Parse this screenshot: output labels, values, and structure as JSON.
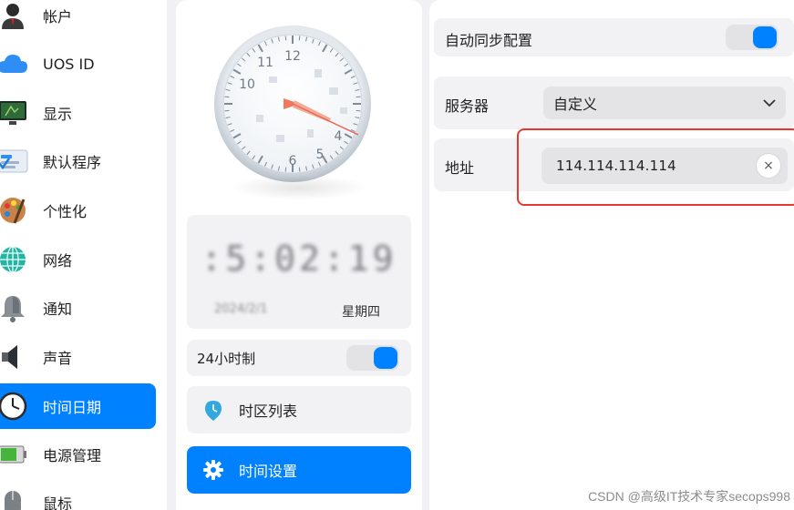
{
  "sidebar": {
    "items": [
      {
        "label": "帐户",
        "icon": "user-icon"
      },
      {
        "label": "UOS ID",
        "icon": "cloud-icon"
      },
      {
        "label": "显示",
        "icon": "monitor-icon"
      },
      {
        "label": "默认程序",
        "icon": "default-apps-icon"
      },
      {
        "label": "个性化",
        "icon": "palette-icon"
      },
      {
        "label": "网络",
        "icon": "network-globe-icon"
      },
      {
        "label": "通知",
        "icon": "bell-icon"
      },
      {
        "label": "声音",
        "icon": "speaker-icon"
      },
      {
        "label": "时间日期",
        "icon": "clock-icon",
        "active": true
      },
      {
        "label": "电源管理",
        "icon": "battery-icon"
      },
      {
        "label": "鼠标",
        "icon": "mouse-icon"
      }
    ]
  },
  "clock": {
    "numerals": {
      "n12": "12",
      "n11": "11",
      "n10": "10",
      "n4": "4",
      "n5": "5",
      "n6": "6"
    },
    "time_digital": ":5:02:19",
    "date": "2024/2/1",
    "weekday": "星期四"
  },
  "settings": {
    "hour24_label": "24小时制",
    "hour24_on": true,
    "timezone_label": "时区列表",
    "time_settings_label": "时间设置"
  },
  "ntp": {
    "auto_sync_label": "自动同步配置",
    "auto_sync_on": true,
    "server_label": "服务器",
    "server_value": "自定义",
    "address_label": "地址",
    "address_value": "114.114.114.114",
    "clear_symbol": "×"
  },
  "colors": {
    "accent": "#0081ff",
    "highlight": "#e8382d"
  },
  "watermark": "CSDN @高级IT技术专家secops998"
}
